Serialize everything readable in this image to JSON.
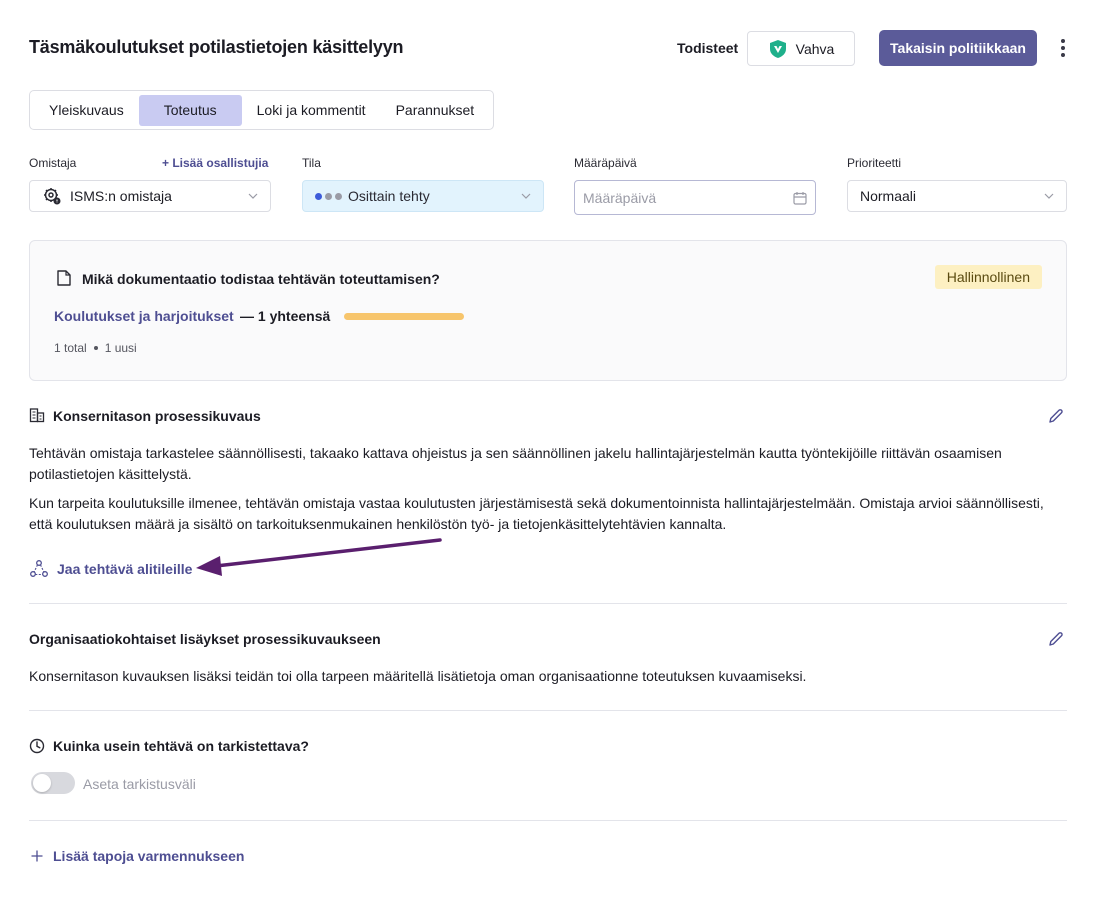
{
  "header": {
    "title": "Täsmäkoulutukset potilastietojen käsittelyyn",
    "evidence_label": "Todisteet",
    "evidence_value": "Vahva",
    "back_button": "Takaisin politiikkaan",
    "menu_icon": "more-vertical-icon"
  },
  "tabs": [
    {
      "label": "Yleiskuvaus",
      "active": false
    },
    {
      "label": "Toteutus",
      "active": true
    },
    {
      "label": "Loki ja kommentit",
      "active": false
    },
    {
      "label": "Parannukset",
      "active": false
    }
  ],
  "fields": {
    "owner": {
      "label": "Omistaja",
      "add_link": "+ Lisää osallistujia",
      "value": "ISMS:n omistaja"
    },
    "status": {
      "label": "Tila",
      "value": "Osittain tehty",
      "dot_colors": [
        "#3d5bd9",
        "#9a9ba6",
        "#9a9ba6"
      ]
    },
    "due_date": {
      "label": "Määräpäivä",
      "placeholder": "Määräpäivä"
    },
    "priority": {
      "label": "Prioriteetti",
      "value": "Normaali"
    }
  },
  "documentation": {
    "question": "Mikä dokumentaatio todistaa tehtävän toteuttamisen?",
    "badge": "Hallinnollinen",
    "link": "Koulutukset ja harjoitukset",
    "count": "— 1 yhteensä",
    "progress": 1.0,
    "stats_total": "1 total",
    "stats_new": "1 uusi"
  },
  "group_process": {
    "title": "Konsernitason prosessikuvaus",
    "paragraph1": "Tehtävän omistaja tarkastelee säännöllisesti, takaako kattava ohjeistus ja sen säännöllinen jakelu hallintajärjestelmän kautta työntekijöille riittävän osaamisen potilastietojen käsittelystä.",
    "paragraph2": "Kun tarpeita koulutuksille ilmenee, tehtävän omistaja vastaa koulutusten järjestämisestä sekä dokumentoinnista hallintajärjestelmään. Omistaja arvioi säännöllisesti, että koulutuksen määrä ja sisältö on tarkoituksenmukainen henkilöstön työ- ja tietojenkäsittelytehtävien kannalta.",
    "share_link": "Jaa tehtävä alitileille"
  },
  "org_additions": {
    "title": "Organisaatiokohtaiset lisäykset prosessikuvaukseen",
    "paragraph": "Konsernitason kuvauksen lisäksi teidän toi olla tarpeen määritellä lisätietoja oman organisaationne toteutuksen kuvaamiseksi."
  },
  "review": {
    "title": "Kuinka usein tehtävä on tarkistettava?",
    "toggle_label": "Aseta tarkistusväli",
    "toggle_on": false
  },
  "add_methods": "Lisää tapoja varmennukseen",
  "colors": {
    "accent": "#5b5b99",
    "link": "#4e4e92",
    "arrow": "#5a1f6e",
    "badge_bg": "#fdf0c2",
    "progress": "#f7c56c"
  }
}
